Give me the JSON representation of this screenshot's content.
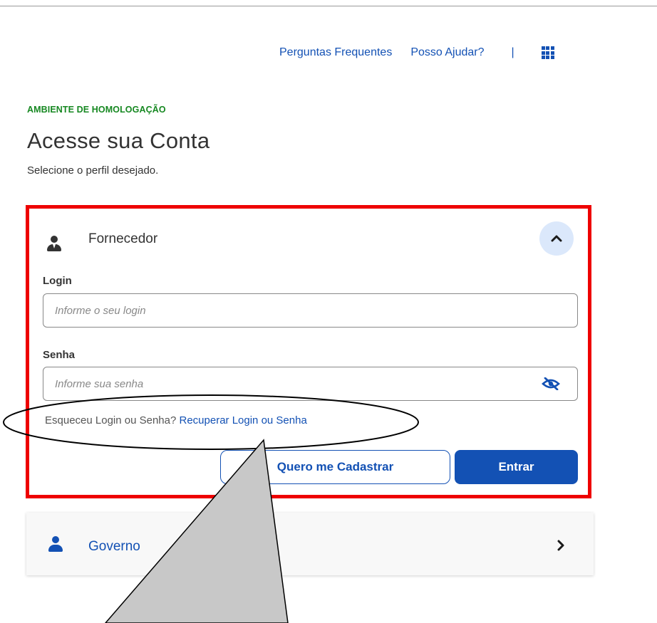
{
  "header": {
    "faq_link": "Perguntas Frequentes",
    "help_link": "Posso Ajudar?",
    "separator": "|",
    "apps_icon": "grid-apps-icon"
  },
  "page": {
    "environment_label": "AMBIENTE DE HOMOLOGAÇÃO",
    "title": "Acesse sua Conta",
    "subtitle": "Selecione o perfil desejado."
  },
  "fornecedor": {
    "profile_label": "Fornecedor",
    "profile_icon": "user-tie-icon",
    "collapse_icon": "chevron-up-icon",
    "login_label": "Login",
    "login_placeholder": "Informe o seu login",
    "login_value": "",
    "senha_label": "Senha",
    "senha_placeholder": "Informe sua senha",
    "senha_value": "",
    "toggle_icon": "eye-slash-icon",
    "forgot_question": "Esqueceu Login ou Senha?",
    "forgot_link": "Recuperar Login ou Senha",
    "register_button": "Quero me Cadastrar",
    "enter_button": "Entrar"
  },
  "governo": {
    "profile_label": "Governo",
    "profile_icon": "user-icon",
    "expand_icon": "chevron-right-icon"
  },
  "colors": {
    "primary": "#1351b4",
    "environment": "#168821",
    "highlight": "#ee0000",
    "callout_fill": "#c8c8c8"
  }
}
